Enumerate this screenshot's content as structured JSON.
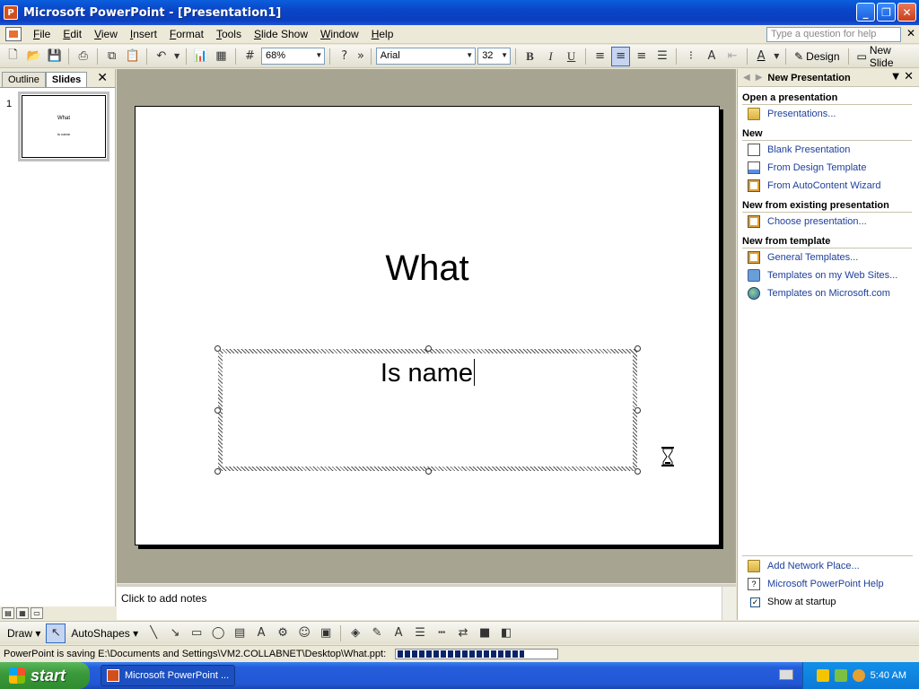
{
  "window": {
    "title": "Microsoft PowerPoint - [Presentation1]"
  },
  "menu": {
    "items": [
      "File",
      "Edit",
      "View",
      "Insert",
      "Format",
      "Tools",
      "Slide Show",
      "Window",
      "Help"
    ],
    "help_placeholder": "Type a question for help"
  },
  "toolbar": {
    "zoom": "68%",
    "font": "Arial",
    "font_size": "32",
    "bold": "B",
    "italic": "I",
    "underline": "U",
    "design_label": "Design",
    "new_slide_label": "New Slide"
  },
  "left_pane": {
    "tabs": [
      "Outline",
      "Slides"
    ],
    "active_tab": "Slides",
    "slide_number": "1",
    "thumb_title": "What",
    "thumb_subtitle": "Is name"
  },
  "slide": {
    "title": "What",
    "subtitle": "Is name"
  },
  "notes": {
    "placeholder": "Click to add notes"
  },
  "task_pane": {
    "title": "New Presentation",
    "sections": [
      {
        "title": "Open a presentation",
        "links": [
          {
            "label": "Presentations...",
            "icon": "folder-icon"
          }
        ]
      },
      {
        "title": "New",
        "links": [
          {
            "label": "Blank Presentation",
            "icon": "blank-doc-icon"
          },
          {
            "label": "From Design Template",
            "icon": "design-template-icon"
          },
          {
            "label": "From AutoContent Wizard",
            "icon": "wizard-icon"
          }
        ]
      },
      {
        "title": "New from existing presentation",
        "links": [
          {
            "label": "Choose presentation...",
            "icon": "existing-doc-icon"
          }
        ]
      },
      {
        "title": "New from template",
        "links": [
          {
            "label": "General Templates...",
            "icon": "general-templates-icon"
          },
          {
            "label": "Templates on my Web Sites...",
            "icon": "web-sites-icon"
          },
          {
            "label": "Templates on Microsoft.com",
            "icon": "globe-icon"
          }
        ]
      }
    ],
    "bottom": {
      "add_network_place": "Add Network Place...",
      "help": "Microsoft PowerPoint Help",
      "show_at_startup": "Show at startup",
      "show_at_startup_checked": true
    }
  },
  "draw_bar": {
    "draw_label": "Draw",
    "autoshapes_label": "AutoShapes"
  },
  "status": {
    "text": "PowerPoint is saving E:\\Documents and Settings\\VM2.COLLABNET\\Desktop\\What.ppt:",
    "progress_fraction": 0.8
  },
  "taskbar": {
    "start_label": "start",
    "task_item_label": "Microsoft PowerPoint ...",
    "clock": "5:40 AM"
  }
}
